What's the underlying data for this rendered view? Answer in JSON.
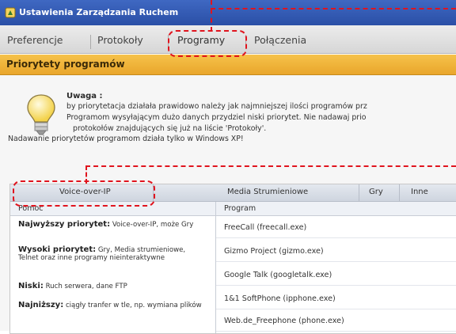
{
  "window": {
    "title": "Ustawienia Zarządzania Ruchem"
  },
  "tabs": [
    {
      "label": "Preferencje"
    },
    {
      "label": "Protokoły"
    },
    {
      "label": "Programy",
      "active": true
    },
    {
      "label": "Połączenia"
    }
  ],
  "section": {
    "title": "Priorytety programów"
  },
  "note": {
    "title": "Uwaga :",
    "lines": [
      "by priorytetacja działała prawidowo należy jak najmniejszej ilości programów prz",
      "Programom wysyłającym dużo danych przydziel niski priorytet. Nie nadawaj prio",
      "protokołów znajdujących się już na liście 'Protokoły'."
    ],
    "footer": "Nadawanie priorytetów programom działa tylko w Windows XP!"
  },
  "categories": [
    {
      "label": "Voice-over-IP"
    },
    {
      "label": "Media Strumieniowe"
    },
    {
      "label": "Gry"
    },
    {
      "label": "Inne"
    }
  ],
  "columns": {
    "help": "Pomoc",
    "program": "Program"
  },
  "help_items": [
    {
      "title": "Najwyższy priorytet:",
      "text": "Voice-over-IP, może Gry"
    },
    {
      "title": "Wysoki priorytet:",
      "text": "Gry, Media strumieniowe, Telnet oraz inne programy nieinteraktywne"
    },
    {
      "title": "Niski:",
      "text": "Ruch serwera, dane FTP"
    },
    {
      "title": "Najniższy:",
      "text": "ciągły tranfer w tle, np. wymiana plików"
    }
  ],
  "programs": [
    "FreeCall (freecall.exe)",
    "Gizmo Project (gizmo.exe)",
    "Google Talk (googletalk.exe)",
    "1&1 SoftPhone (ipphone.exe)",
    "Web.de_Freephone (phone.exe)"
  ],
  "colors": {
    "titlebar": "#2f56ad",
    "section_header": "#eeb23a",
    "annotation": "#e0141e"
  },
  "icons": {
    "app": "app-icon",
    "note": "lightbulb-icon"
  }
}
